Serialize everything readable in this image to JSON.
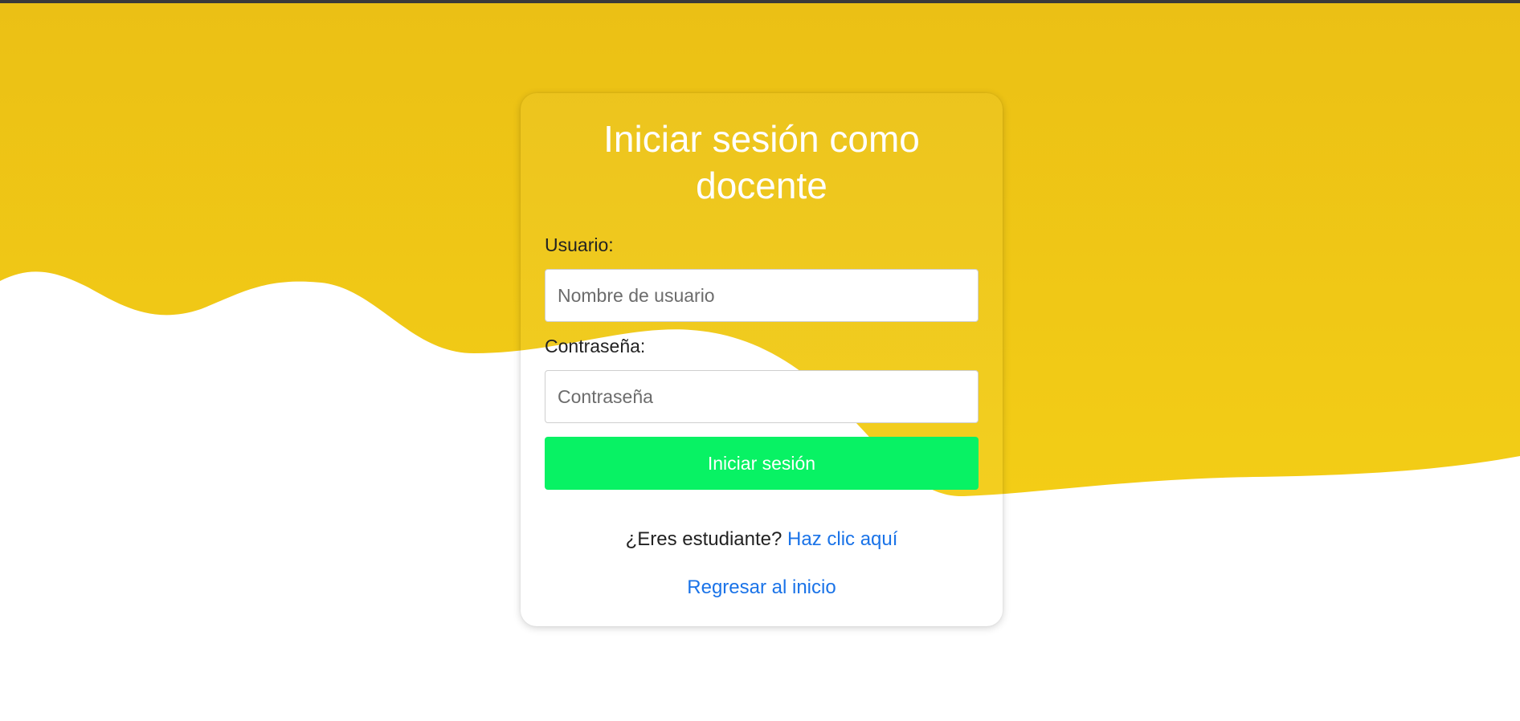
{
  "colors": {
    "background_yellow": "#f2cb17",
    "button_green": "#08f264",
    "link_blue": "#1a73e8",
    "title_text": "#ffffff"
  },
  "login": {
    "title_line1": "Iniciar sesión como",
    "title_line2": "docente",
    "user_label": "Usuario:",
    "user_placeholder": "Nombre de usuario",
    "user_value": "",
    "password_label": "Contraseña:",
    "password_placeholder": "Contraseña",
    "password_value": "",
    "submit_label": "Iniciar sesión",
    "student_prompt": "¿Eres estudiante?",
    "student_link": "Haz clic aquí",
    "back_link": "Regresar al inicio"
  }
}
